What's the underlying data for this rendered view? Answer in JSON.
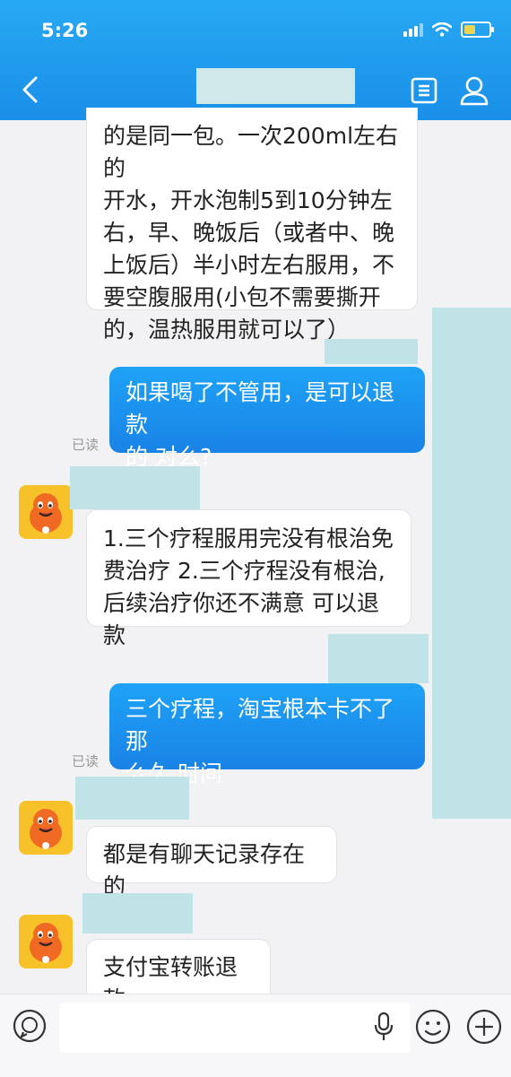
{
  "status_bar": {
    "time": "5:26"
  },
  "messages": [
    {
      "side": "in",
      "text_lines": [
        "的是同一包。一次200ml左右的",
        "开水，开水泡制5到10分钟左",
        "右，早、晚饭后（或者中、晚",
        "上饭后）半小时左右服用，不",
        "要空腹服用(小包不需要撕开",
        "的，温热服用就可以了）"
      ]
    },
    {
      "side": "out",
      "text_lines": [
        "如果喝了不管用，是可以退款",
        "的 对么?"
      ],
      "status": "已读"
    },
    {
      "side": "in",
      "text_lines": [
        "1.三个疗程服用完没有根治免",
        "费治疗  2.三个疗程没有根治,",
        "后续治疗你还不满意 可以退款"
      ]
    },
    {
      "side": "out",
      "text_lines": [
        "三个疗程，淘宝根本卡不了那",
        "么久 时间"
      ],
      "status": "已读"
    },
    {
      "side": "in",
      "text_lines": [
        "都是有聊天记录存在的"
      ]
    },
    {
      "side": "in",
      "text_lines": [
        "支付宝转账退款"
      ]
    }
  ],
  "input": {
    "placeholder": ""
  },
  "icons": {
    "back": "chevron-left-icon",
    "doc": "document-icon",
    "user": "user-icon",
    "chat": "chat-bubble-icon",
    "mic": "microphone-icon",
    "emoji": "emoji-icon",
    "plus": "plus-icon"
  },
  "colors": {
    "header": "#1a8fe8",
    "outgoing_bubble": "#1a8fe8",
    "incoming_bubble": "#ffffff",
    "redaction": "#bfe3e7",
    "avatar": "#f7c229"
  }
}
